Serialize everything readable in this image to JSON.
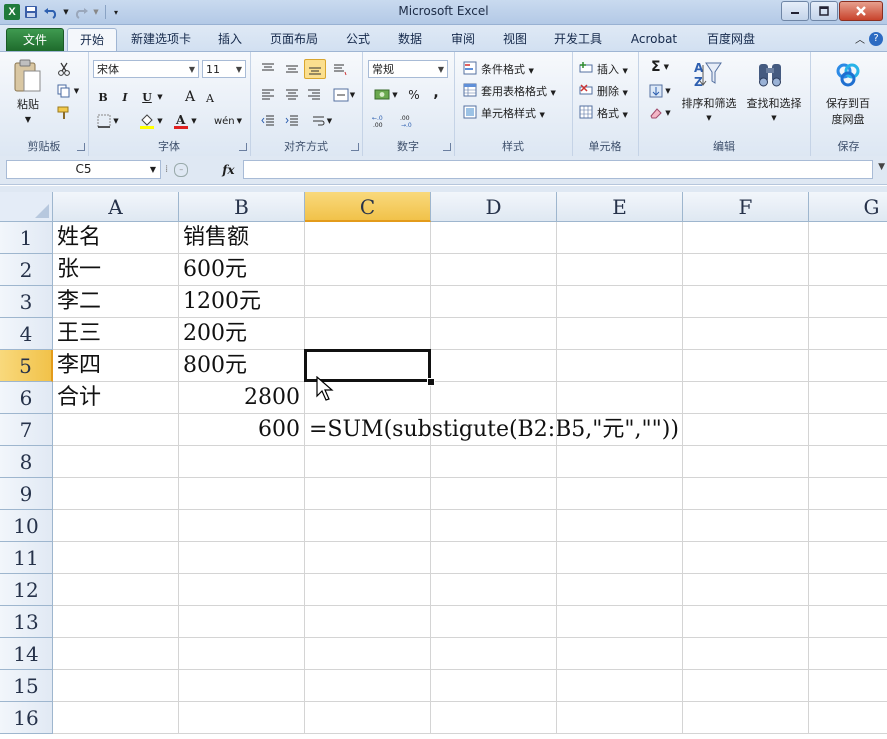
{
  "window": {
    "title": "Microsoft Excel",
    "app_icon_letter": "X"
  },
  "quick_access": {
    "icons": [
      "save-icon",
      "undo-icon",
      "redo-icon",
      "customize-qat-icon"
    ]
  },
  "ribbon_tabs": [
    {
      "label": "文件",
      "kind": "file"
    },
    {
      "label": "开始",
      "kind": "active"
    },
    {
      "label": "新建选项卡"
    },
    {
      "label": "插入"
    },
    {
      "label": "页面布局"
    },
    {
      "label": "公式"
    },
    {
      "label": "数据"
    },
    {
      "label": "审阅"
    },
    {
      "label": "视图"
    },
    {
      "label": "开发工具"
    },
    {
      "label": "Acrobat"
    },
    {
      "label": "百度网盘"
    }
  ],
  "ribbon": {
    "clipboard": {
      "label": "剪贴板",
      "paste": "粘贴"
    },
    "font": {
      "label": "字体",
      "font_name": "宋体",
      "font_size": "11",
      "bold": "B",
      "italic": "I",
      "underline": "U",
      "grow": "A",
      "shrink": "A",
      "phonetic": "wén"
    },
    "alignment": {
      "label": "对齐方式"
    },
    "number": {
      "label": "数字",
      "format": "常规",
      "percent": "%",
      "comma": ","
    },
    "styles": {
      "label": "样式",
      "conditional_format": "条件格式",
      "table_format": "套用表格格式",
      "cell_styles": "单元格样式"
    },
    "cells": {
      "label": "单元格",
      "insert": "插入",
      "delete": "删除",
      "format": "格式"
    },
    "editing": {
      "label": "编辑",
      "sum": "Σ",
      "sort_filter": "排序和筛选",
      "find_select": "查找和选择"
    },
    "save": {
      "label": "保存",
      "save_baidu_line1": "保存到百",
      "save_baidu_line2": "度网盘"
    }
  },
  "formula_bar": {
    "name_box": "C5",
    "fx": "fx",
    "formula": ""
  },
  "colors": {
    "selected_header": "#f1c24a",
    "grid_line": "#d4d4d4",
    "file_tab": "#2f8a42"
  },
  "grid": {
    "columns": [
      "A",
      "B",
      "C",
      "D",
      "E",
      "F",
      "G"
    ],
    "rows": [
      "1",
      "2",
      "3",
      "4",
      "5",
      "6",
      "7",
      "8",
      "9",
      "10",
      "11",
      "12",
      "13",
      "14",
      "15",
      "16"
    ],
    "selected_cell": "C5",
    "cells": {
      "A1": "姓名",
      "B1": "销售额",
      "A2": "张一",
      "B2": "600元",
      "A3": "李二",
      "B3": "1200元",
      "A4": "王三",
      "B4": "200元",
      "A5": "李四",
      "B5": "800元",
      "A6": "合计",
      "B6": "2800",
      "B7": "600",
      "C7": "=SUM(substigute(B2:B5,\"元\",\"\"))"
    }
  }
}
